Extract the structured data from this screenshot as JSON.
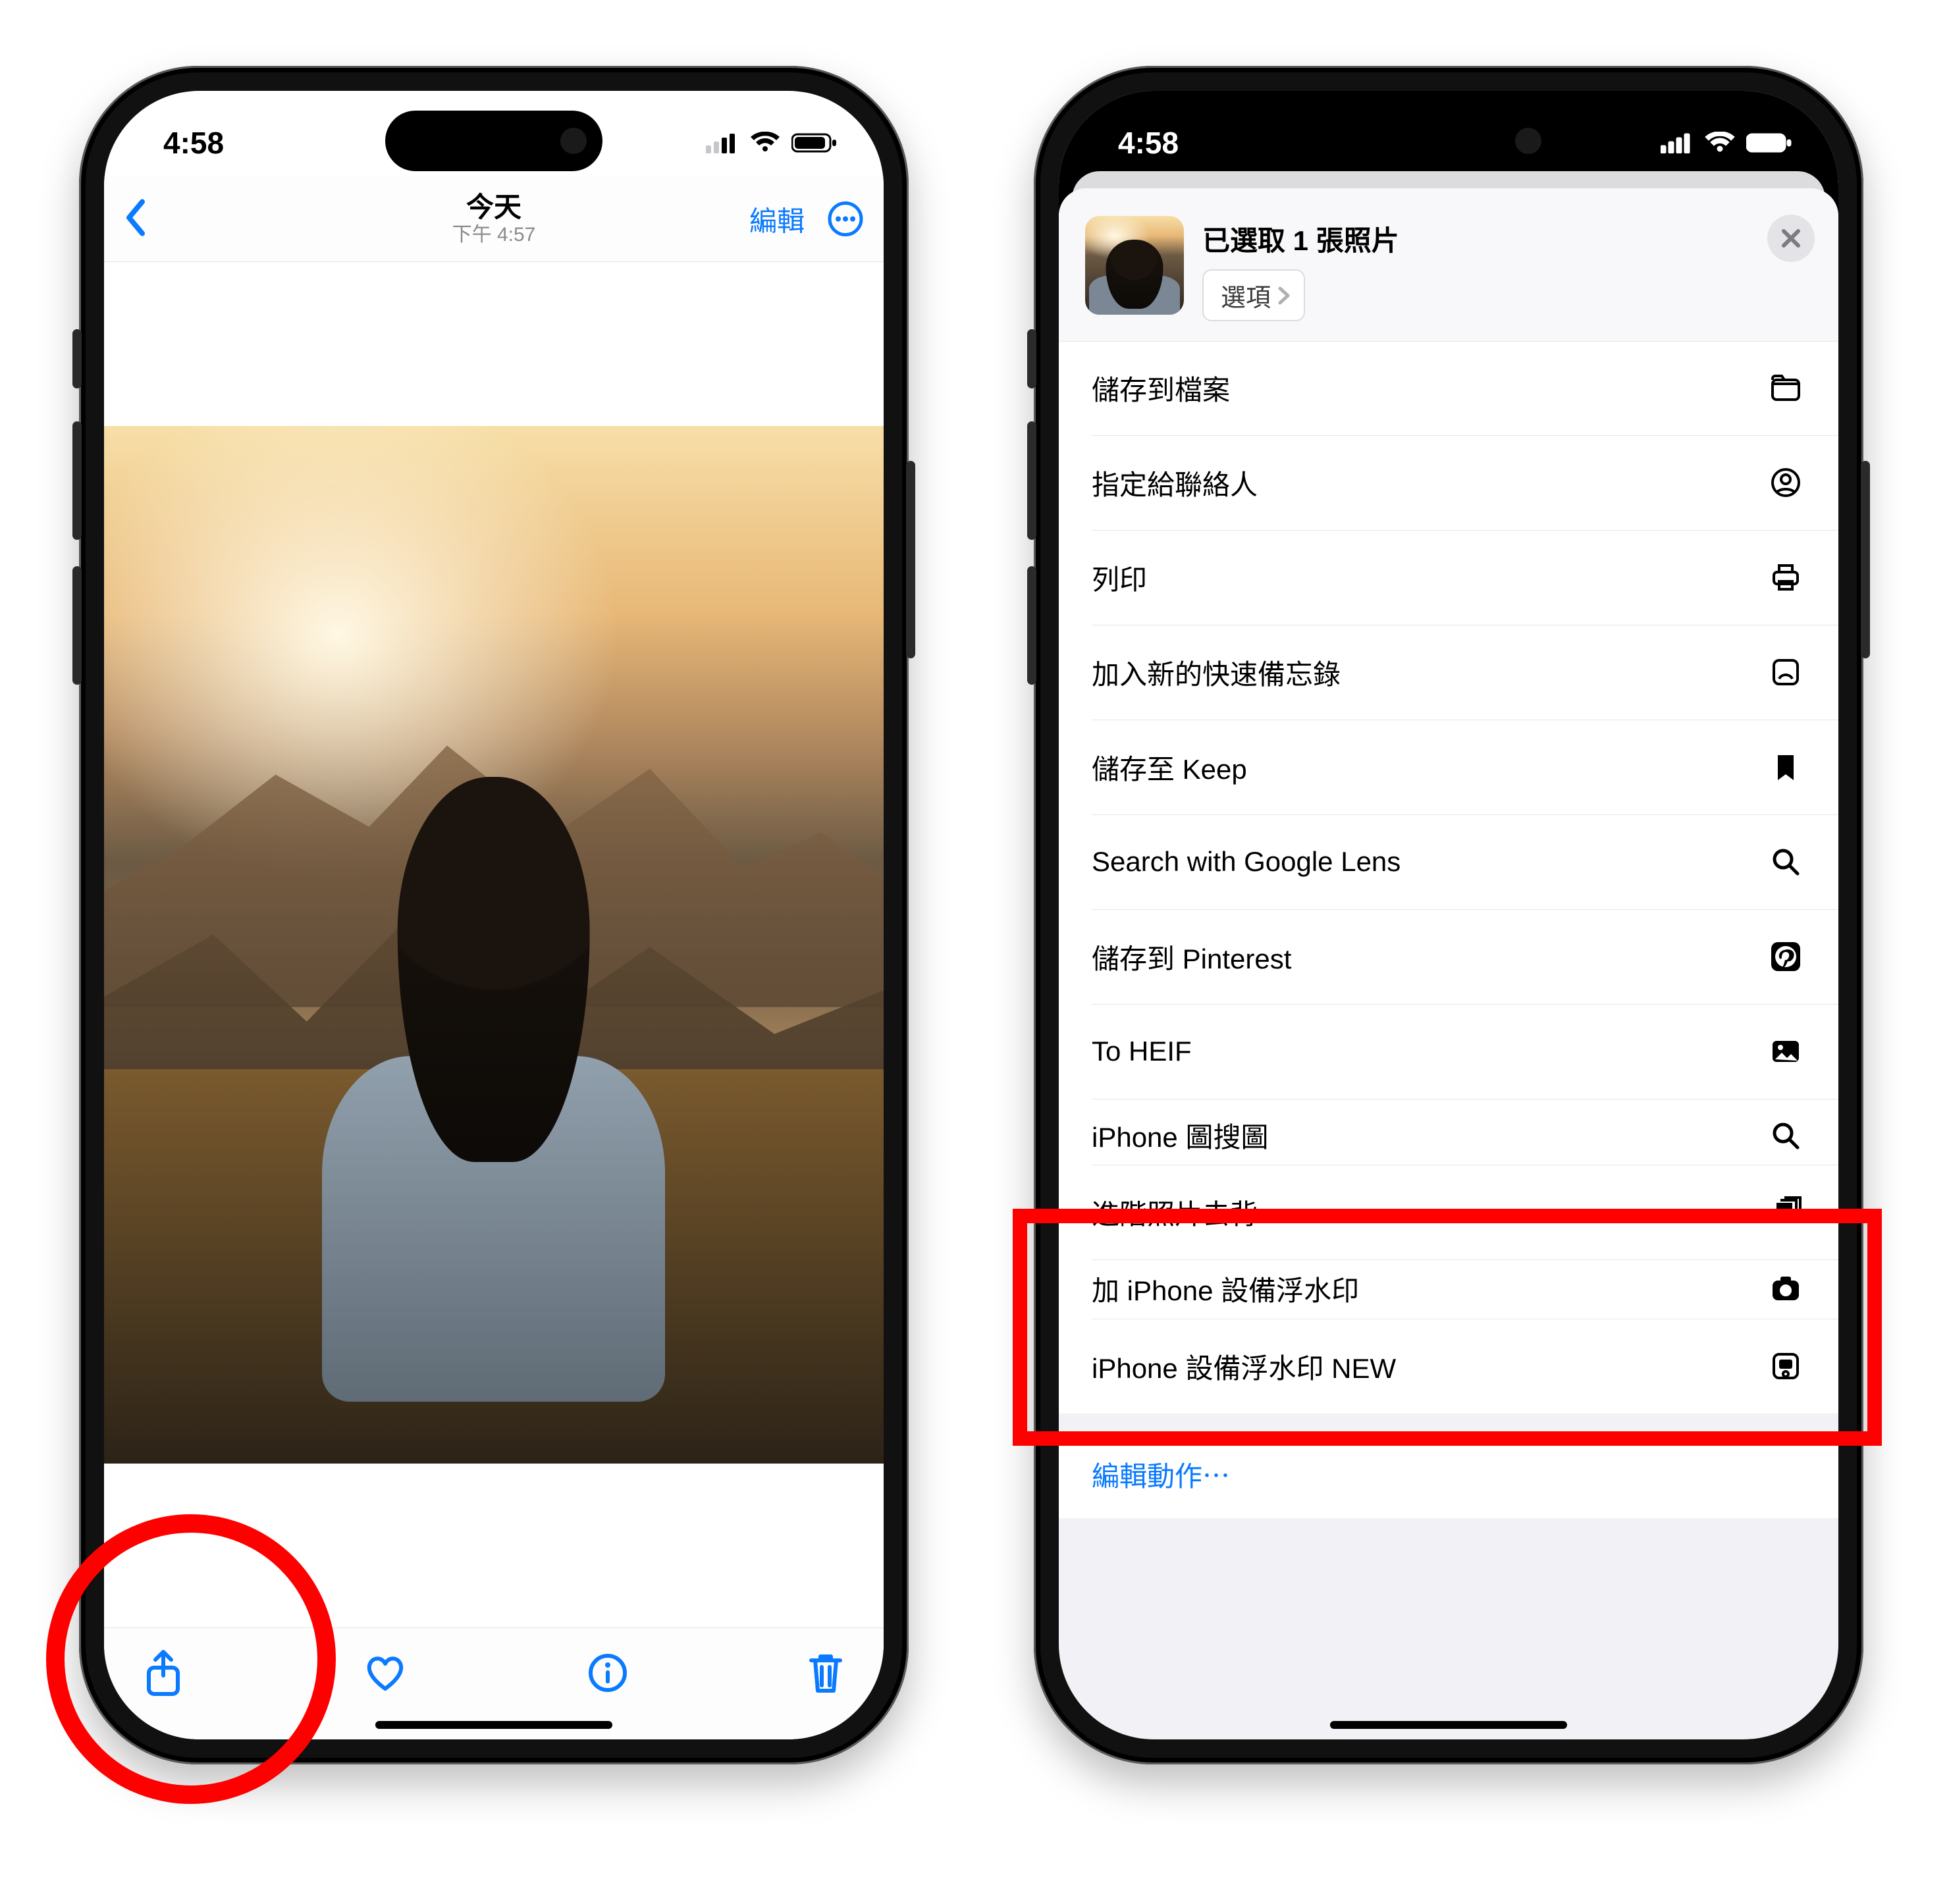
{
  "status": {
    "time": "4:58"
  },
  "left_phone": {
    "header": {
      "title": "今天",
      "subtitle": "下午 4:57",
      "edit": "編輯"
    }
  },
  "right_phone": {
    "sheet_header": {
      "title": "已選取 1 張照片",
      "options_label": "選項"
    },
    "actions": [
      {
        "label": "儲存到檔案",
        "icon": "folder"
      },
      {
        "label": "指定給聯絡人",
        "icon": "contact"
      },
      {
        "label": "列印",
        "icon": "printer"
      },
      {
        "label": "加入新的快速備忘錄",
        "icon": "quicknote"
      },
      {
        "label": "儲存至 Keep",
        "icon": "bookmark"
      },
      {
        "label": "Search with Google Lens",
        "icon": "search"
      },
      {
        "label": "儲存到 Pinterest",
        "icon": "pinterest"
      },
      {
        "label": "To HEIF",
        "icon": "image"
      },
      {
        "label": "iPhone 圖搜圖",
        "icon": "search"
      },
      {
        "label": "進階照片去背",
        "icon": "stack"
      },
      {
        "label": "加 iPhone 設備浮水印",
        "icon": "camera"
      },
      {
        "label": "iPhone 設備浮水印 NEW",
        "icon": "device"
      }
    ],
    "edit_actions": "編輯動作⋯"
  }
}
